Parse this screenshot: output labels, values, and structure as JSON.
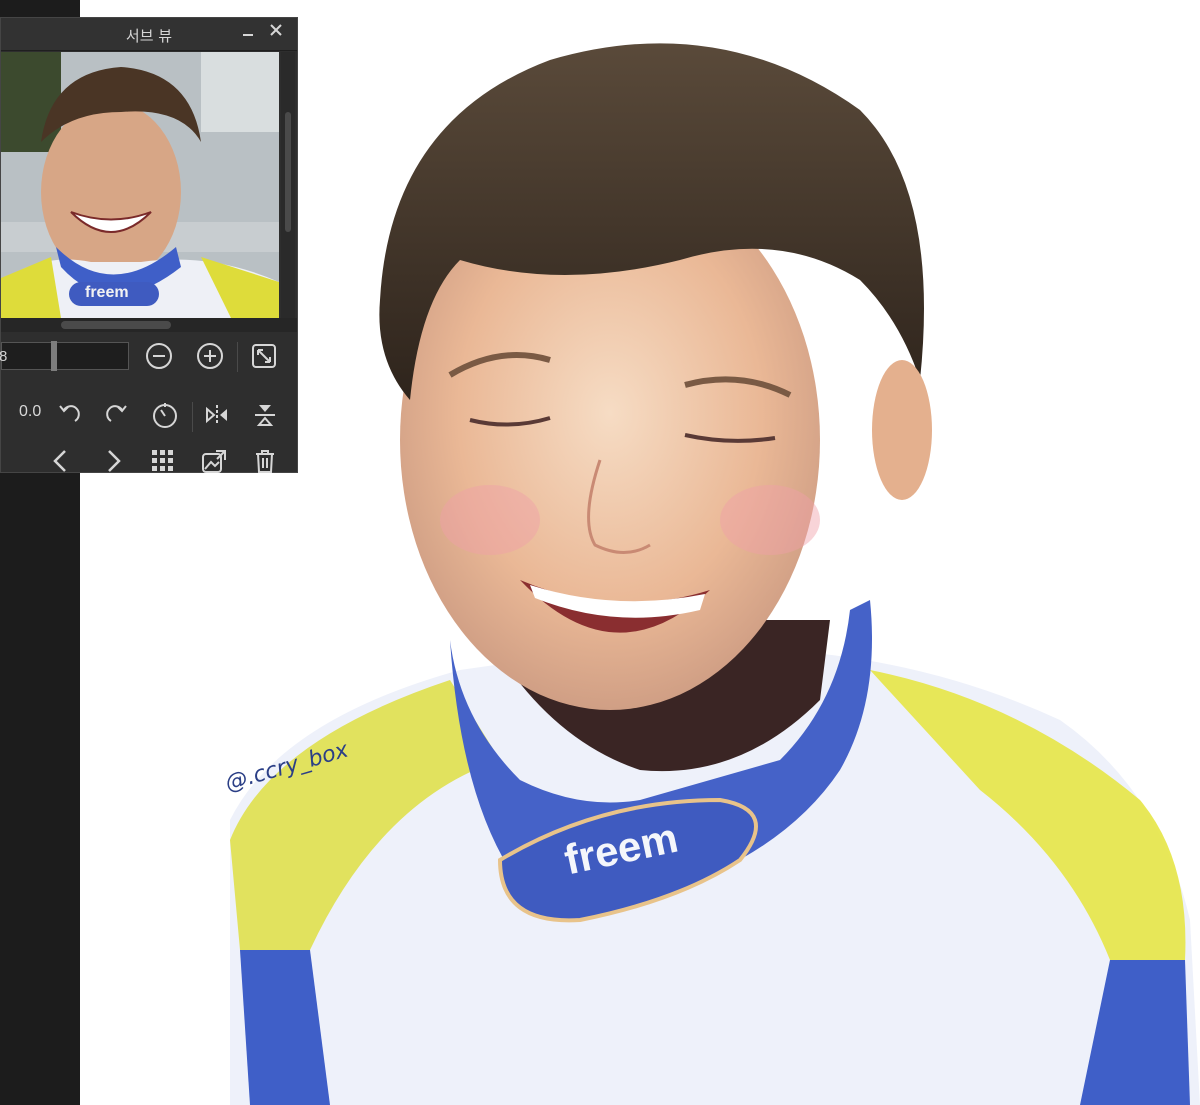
{
  "subview": {
    "title": "서브 뷰",
    "minimize_label": "_",
    "close_label": "✕",
    "zoom_value": "8",
    "angle_value": "0.0",
    "preview_badge_text": "freem",
    "icons": [
      "zoom-out-icon",
      "zoom-in-icon",
      "fit-window-icon",
      "rotate-left-icon",
      "rotate-right-icon",
      "reset-rotation-icon",
      "flip-horizontal-icon",
      "flip-vertical-icon",
      "previous-icon",
      "next-icon",
      "grid-icon",
      "import-image-icon",
      "trash-icon"
    ]
  },
  "canvas": {
    "signature": "@.ccry_box",
    "collar_text": "freem"
  },
  "colors": {
    "panel_bg": "#2e2e2e",
    "left_strip": "#1c1c1c",
    "suit_blue": "#3f5fc8",
    "suit_yellow": "#e3e04a"
  }
}
